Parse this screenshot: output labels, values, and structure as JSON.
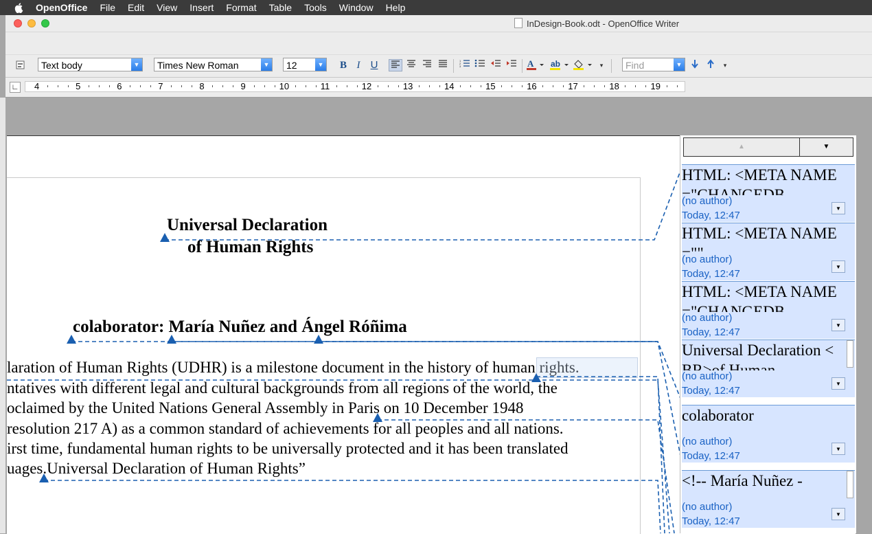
{
  "menubar": {
    "app_name": "OpenOffice",
    "items": [
      "File",
      "Edit",
      "View",
      "Insert",
      "Format",
      "Table",
      "Tools",
      "Window",
      "Help"
    ]
  },
  "window": {
    "title": "InDesign-Book.odt - OpenOffice Writer"
  },
  "toolbar": {
    "paragraph_style": "Text body",
    "font_name": "Times New Roman",
    "font_size": "12",
    "bold_label": "B",
    "italic_label": "I",
    "underline_label": "U",
    "find_placeholder": "Find"
  },
  "ruler": {
    "numbers": [
      "4",
      "5",
      "6",
      "7",
      "8",
      "9",
      "10",
      "11",
      "12",
      "13",
      "14",
      "15",
      "16",
      "17",
      "18",
      "19"
    ]
  },
  "document": {
    "title_line1": "Universal Declaration",
    "title_line2": "of Human Rights",
    "collaborator": "colaborator: María Nuñez and Ángel Róñima",
    "body_lines": [
      "laration of Human Rights (UDHR) is a milestone document in the history of human rights.",
      "ntatives with different legal and cultural backgrounds from all regions of the world, the",
      "oclaimed by the United Nations General Assembly in Paris on 10 December 1948",
      " resolution 217 A) as a common standard of achievements for all peoples and all nations.",
      "irst time, fundamental human rights to be universally protected and it has been translated",
      "uages.Universal Declaration of Human Rights”"
    ]
  },
  "comments": [
    {
      "text": "HTML: <META NAME=\"CHANGEDB",
      "author": "(no author)",
      "date": "Today, 12:47"
    },
    {
      "text": "HTML: <META NAME=\"\"",
      "author": "(no author)",
      "date": "Today, 12:47"
    },
    {
      "text": "HTML: <META NAME=\"CHANGEDB",
      "author": "(no author)",
      "date": "Today, 12:47"
    },
    {
      "text": "Universal Declaration <BR>of Human",
      "author": "(no author)",
      "date": "Today, 12:47"
    },
    {
      "text": "colaborator",
      "author": "(no author)",
      "date": "Today, 12:47"
    },
    {
      "text": "<!-- María Nuñez -",
      "author": "(no author)",
      "date": "Today, 12:47"
    }
  ],
  "colors": {
    "accent": "#1a5fb0",
    "comment_bg": "#d7e5ff",
    "author_text": "#1a62c4"
  }
}
